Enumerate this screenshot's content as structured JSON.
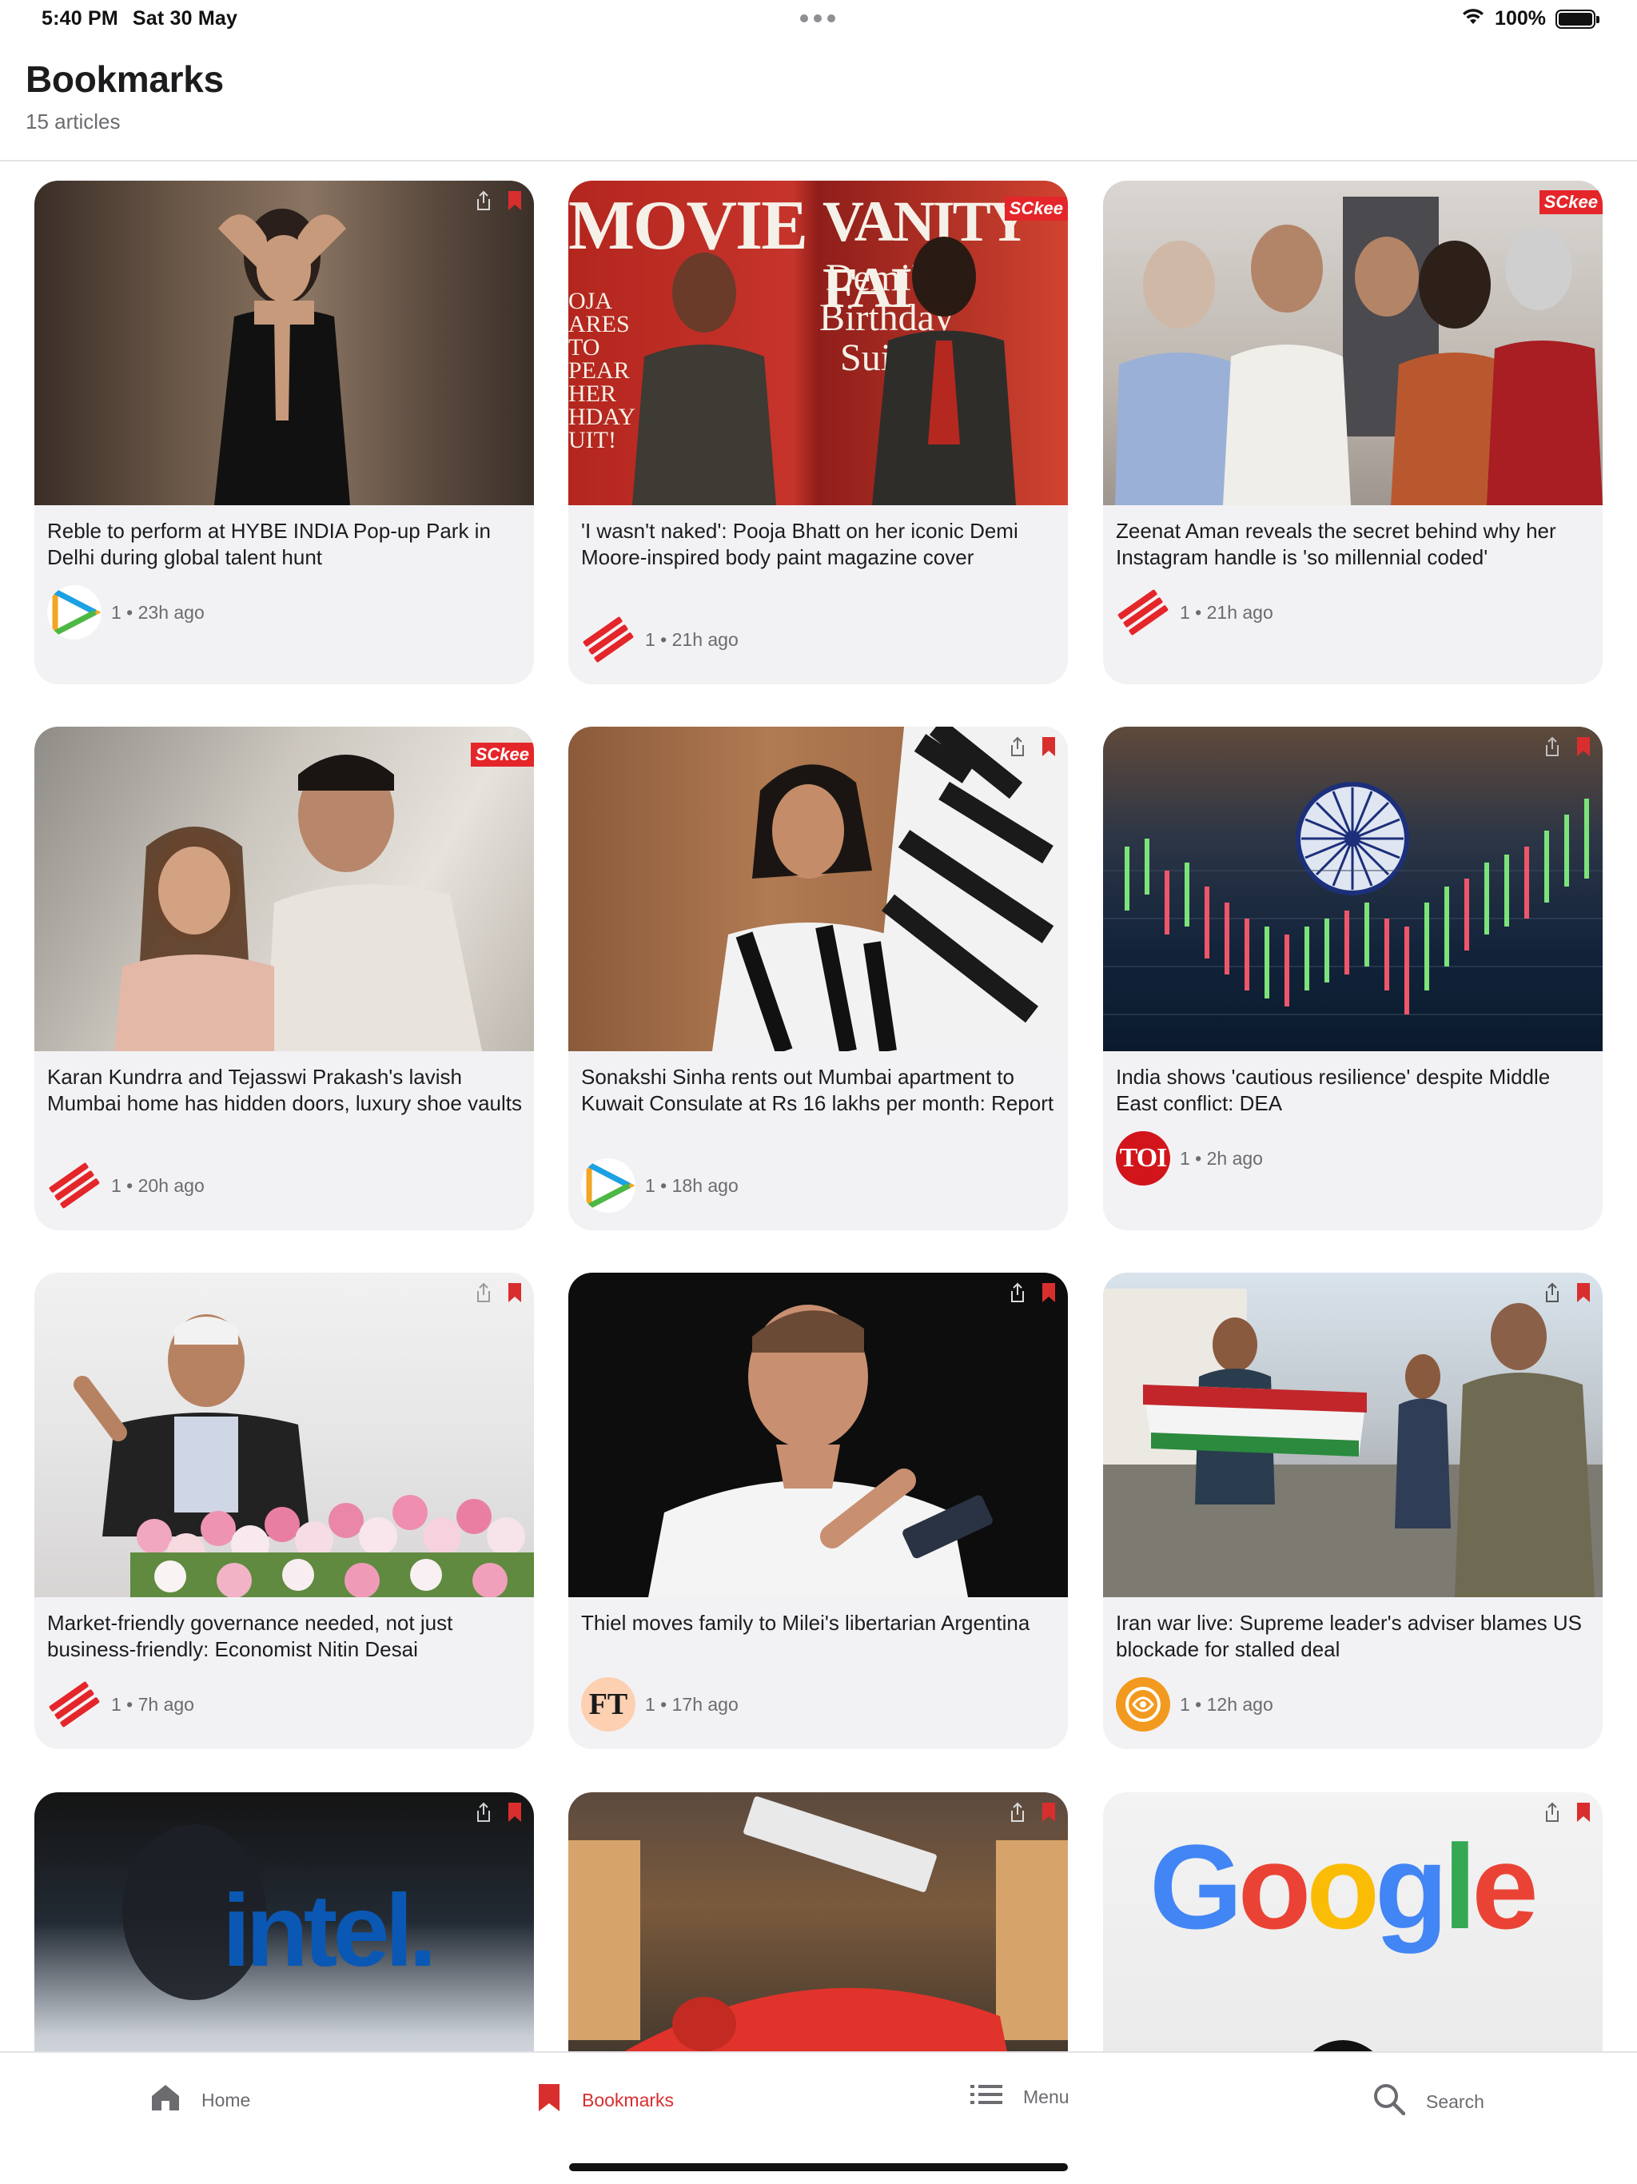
{
  "status_bar": {
    "time": "5:40 PM",
    "date": "Sat 30 May",
    "battery": "100%"
  },
  "header": {
    "title": "Bookmarks",
    "subtitle": "15 articles"
  },
  "articles": [
    {
      "title": "Reble to perform at HYBE INDIA Pop-up Park in Delhi during global talent hunt",
      "meta": "1 • 23h ago",
      "source_icon": "play-logo"
    },
    {
      "title": "'I wasn't naked': Pooja Bhatt on her iconic Demi Moore-inspired body paint magazine cover",
      "meta": "1 • 21h ago",
      "source_icon": "express-logo"
    },
    {
      "title": "Zeenat Aman reveals the secret behind why her Instagram handle is 'so millennial coded'",
      "meta": "1 • 21h ago",
      "source_icon": "express-logo"
    },
    {
      "title": "Karan Kundrra and Tejasswi Prakash's lavish Mumbai home has hidden doors, luxury shoe vaults",
      "meta": "1 • 20h ago",
      "source_icon": "express-logo"
    },
    {
      "title": "Sonakshi Sinha rents out Mumbai apartment to Kuwait Consulate at Rs 16 lakhs per month: Report",
      "meta": "1 • 18h ago",
      "source_icon": "play-logo"
    },
    {
      "title": "India shows 'cautious resilience' despite Middle East conflict: DEA",
      "meta": "1 • 2h ago",
      "source_icon": "toi-logo",
      "source_text": "TOI"
    },
    {
      "title": "Market-friendly governance needed, not just business-friendly: Economist Nitin Desai",
      "meta": "1 • 7h ago",
      "source_icon": "express-logo"
    },
    {
      "title": "Thiel moves family to Milei's libertarian Argentina",
      "meta": "1 • 17h ago",
      "source_icon": "ft-logo",
      "source_text": "FT"
    },
    {
      "title": "Iran war live: Supreme leader's adviser blames US blockade for stalled deal",
      "meta": "1 • 12h ago",
      "source_icon": "aljazeera-logo"
    },
    {
      "image_text": "intel."
    },
    {
      "image_text": ""
    },
    {
      "image_text": "Google"
    }
  ],
  "image_overlays": {
    "movie_left": "MOVIE",
    "movie_right": "VANITY FAI",
    "demi_line1": "Demi's",
    "demi_line2": "Birthday",
    "demi_line3": "Suit",
    "pooja_side": "OJA\nARES\nTO\nPEAR\nHER\nHDAY\nUIT!",
    "sckee": "SCkee"
  },
  "tab_bar": {
    "home": "Home",
    "bookmarks": "Bookmarks",
    "menu": "Menu",
    "search": "Search"
  },
  "colors": {
    "accent": "#d92e2e",
    "card_bg": "#f2f2f5",
    "express_red": "#e4262a",
    "toi_red": "#d2151b",
    "ft_pink": "#fcd0b1",
    "aljazeera_orange": "#f29a1f"
  }
}
